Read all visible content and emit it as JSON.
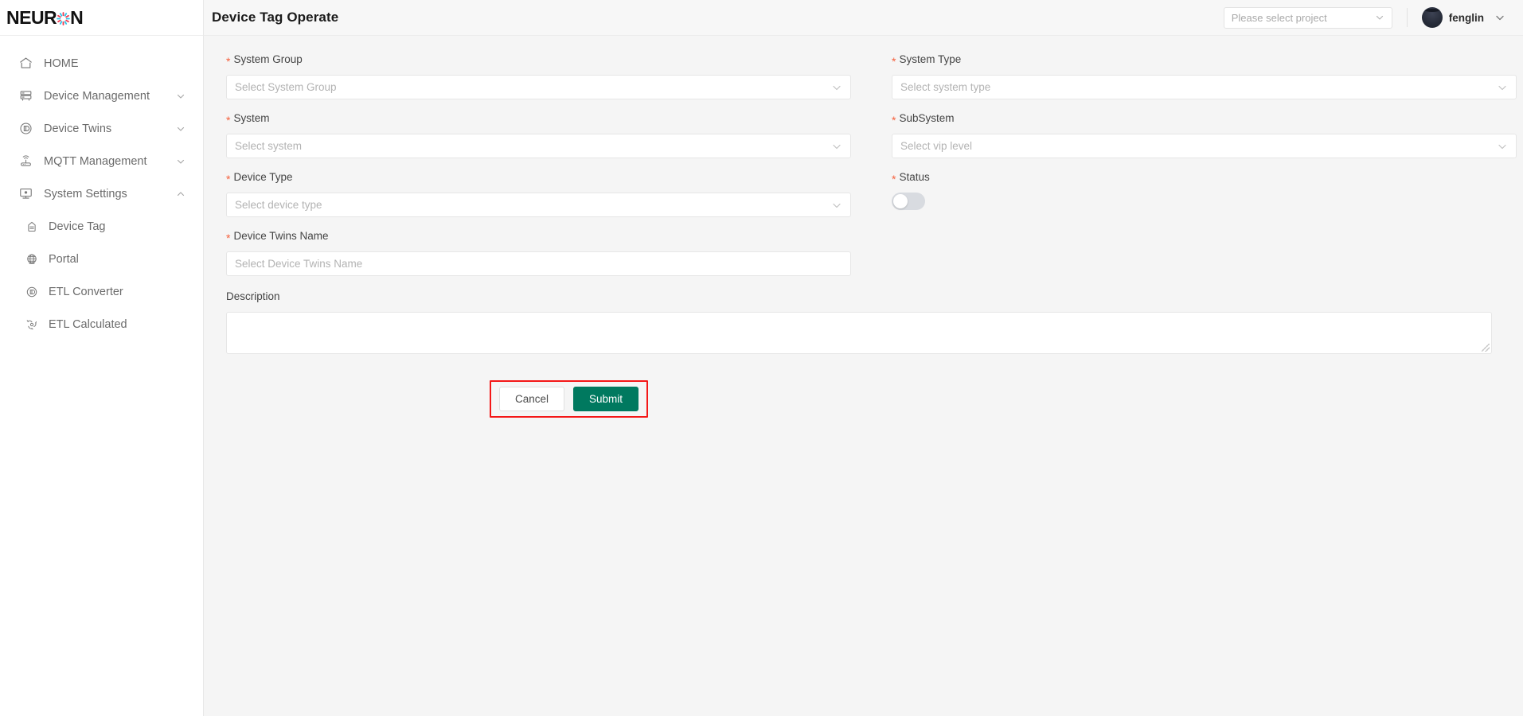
{
  "brand": {
    "name_part1": "NEUR",
    "name_part2": "N",
    "logo_icon": "neuron-dot-icon"
  },
  "sidebar": {
    "items": [
      {
        "label": "HOME",
        "icon": "home-icon",
        "has_caret": false,
        "level": "top"
      },
      {
        "label": "Device Management",
        "icon": "server-icon",
        "has_caret": true,
        "level": "top"
      },
      {
        "label": "Device Twins",
        "icon": "twins-circle-icon",
        "has_caret": true,
        "level": "top"
      },
      {
        "label": "MQTT Management",
        "icon": "router-wifi-icon",
        "has_caret": true,
        "level": "top"
      },
      {
        "label": "System Settings",
        "icon": "monitor-icon",
        "has_caret": true,
        "level": "top",
        "expanded": true
      },
      {
        "label": "Device Tag",
        "icon": "tag-device-icon",
        "has_caret": false,
        "level": "sub"
      },
      {
        "label": "Portal",
        "icon": "globe-icon",
        "has_caret": false,
        "level": "sub"
      },
      {
        "label": "ETL Converter",
        "icon": "converter-circle-icon",
        "has_caret": false,
        "level": "sub"
      },
      {
        "label": "ETL Calculated",
        "icon": "calculated-gear-icon",
        "has_caret": false,
        "level": "sub"
      }
    ]
  },
  "topbar": {
    "title": "Device Tag Operate",
    "project_select": {
      "value": "Please select project",
      "icon": "chevron-down-icon"
    },
    "user": {
      "name": "fenglin",
      "avatar_icon": "user-avatar",
      "caret_icon": "chevron-down-icon"
    }
  },
  "form": {
    "fields": [
      {
        "id": "system-group",
        "label": "System Group",
        "required": true,
        "control": "select",
        "placeholder": "Select System Group",
        "value": "",
        "column": "left"
      },
      {
        "id": "system-type",
        "label": "System Type",
        "required": true,
        "control": "select",
        "placeholder": "Select system type",
        "value": "",
        "column": "right"
      },
      {
        "id": "system",
        "label": "System",
        "required": true,
        "control": "select",
        "placeholder": "Select system",
        "value": "",
        "column": "left"
      },
      {
        "id": "subsystem",
        "label": "SubSystem",
        "required": true,
        "control": "select",
        "placeholder": "Select vip level",
        "value": "",
        "column": "right"
      },
      {
        "id": "device-type",
        "label": "Device Type",
        "required": true,
        "control": "select",
        "placeholder": "Select device type",
        "value": "",
        "column": "left"
      },
      {
        "id": "status",
        "label": "Status",
        "required": true,
        "control": "toggle",
        "value": "off",
        "column": "right"
      },
      {
        "id": "device-twins-name",
        "label": "Device Twins Name",
        "required": true,
        "control": "input",
        "placeholder": "Select Device Twins Name",
        "value": "",
        "column": "left"
      }
    ],
    "description": {
      "label": "Description",
      "required": false,
      "placeholder": "",
      "value": ""
    },
    "actions": {
      "cancel_label": "Cancel",
      "submit_label": "Submit",
      "highlight_color": "#f41717",
      "submit_color": "#00795f"
    }
  }
}
